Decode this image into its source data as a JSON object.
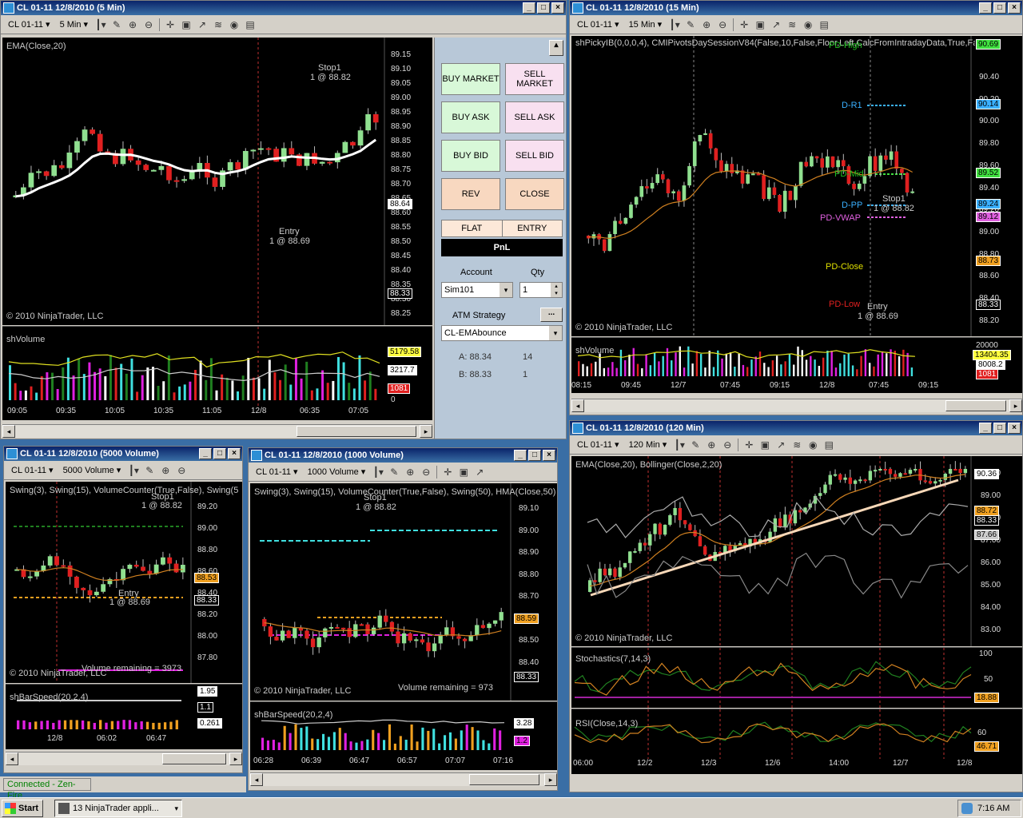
{
  "windows": {
    "w5min": {
      "title": "CL 01-11  12/8/2010 (5 Min)",
      "instrument": "CL 01-11",
      "interval": "5 Min",
      "indicator": "EMA(Close,20)",
      "copyright": "© 2010 NinjaTrader, LLC",
      "stop_label": "Stop1",
      "stop_qty": "1 @ 88.82",
      "entry_label": "Entry",
      "entry_qty": "1 @ 88.69",
      "axis": [
        "89.15",
        "89.10",
        "89.05",
        "89.00",
        "88.95",
        "88.90",
        "88.85",
        "88.80",
        "88.75",
        "88.70",
        "88.65",
        "88.60",
        "88.55",
        "88.50",
        "88.45",
        "88.40",
        "88.35",
        "88.30",
        "88.25"
      ],
      "last_price": "88.64",
      "bid_price": "88.33",
      "vol_label": "shVolume",
      "vol_tags": [
        "5179.58",
        "3217.7",
        "1081"
      ],
      "vol_zero": "0",
      "times": [
        "09:05",
        "09:35",
        "10:05",
        "10:35",
        "11:05",
        "12/8",
        "06:35",
        "07:05"
      ]
    },
    "w15min": {
      "title": "CL 01-11  12/8/2010 (15 Min)",
      "instrument": "CL 01-11",
      "interval": "15 Min",
      "indicator": "shPickyIB(0,0,0,4),  CMIPivotsDaySessionV84(False,10,False,Floor,Left,CalcFromIntradayData,True,False",
      "copyright": "© 2010 NinjaTrader, LLC",
      "pivots": [
        "PD-High",
        "D-R1",
        "PD-Mid",
        "D-PP",
        "PD-VWAP",
        "PD-Close",
        "PD-Low"
      ],
      "stop_label": "Stop1",
      "stop_qty": "1 @ 88.82",
      "entry_label": "Entry",
      "entry_qty": "1 @ 88.69",
      "axis": [
        "90.40",
        "90.20",
        "90.00",
        "89.80",
        "89.60",
        "89.40",
        "89.20",
        "89.00",
        "88.80",
        "88.60",
        "88.40",
        "88.20"
      ],
      "tags": [
        "90.69",
        "90.14",
        "89.52",
        "89.24",
        "89.12",
        "88.73",
        "88.33"
      ],
      "vol_label": "shVolume",
      "vol_tags": [
        "20000",
        "13404.35",
        "8008.2",
        "1081"
      ],
      "times": [
        "08:15",
        "09:45",
        "12/7",
        "07:45",
        "09:15",
        "12/8",
        "07:45",
        "09:15"
      ]
    },
    "w5000v": {
      "title": "CL 01-11  12/8/2010 (5000 Volume)",
      "instrument": "CL 01-11",
      "interval": "5000 Volume",
      "indicator": "Swing(3), Swing(15), VolumeCounter(True,False), Swing(5",
      "copyright": "© 2010 NinjaTrader, LLC",
      "remaining": "Volume remaining = 3973",
      "stop_label": "Stop1",
      "stop_qty": "1 @ 88.82",
      "entry_label": "Entry",
      "entry_qty": "1 @ 88.69",
      "axis": [
        "89.20",
        "89.00",
        "88.80",
        "88.60",
        "88.40",
        "88.20",
        "88.00",
        "87.80"
      ],
      "tags": [
        "88.53",
        "88.33"
      ],
      "sub_label": "shBarSpeed(20,2,4)",
      "sub_tags": [
        "1.95",
        "1.1",
        "0.261"
      ],
      "times": [
        "12/8",
        "06:02",
        "06:47"
      ]
    },
    "w1000v": {
      "title": "CL 01-11  12/8/2010 (1000 Volume)",
      "instrument": "CL 01-11",
      "interval": "1000 Volume",
      "indicator": "Swing(3), Swing(15), VolumeCounter(True,False), Swing(50), HMA(Close,50)",
      "copyright": "© 2010 NinjaTrader, LLC",
      "remaining": "Volume remaining = 973",
      "stop_label": "Stop1",
      "stop_qty": "1 @ 88.82",
      "axis": [
        "89.10",
        "89.00",
        "88.90",
        "88.80",
        "88.70",
        "88.60",
        "88.50",
        "88.40"
      ],
      "tags": [
        "88.59",
        "88.33"
      ],
      "sub_label": "shBarSpeed(20,2,4)",
      "sub_tags": [
        "3.28",
        "1.2"
      ],
      "times": [
        "06:28",
        "06:39",
        "06:47",
        "06:57",
        "07:07",
        "07:16"
      ]
    },
    "w120": {
      "title": "CL 01-11  12/8/2010 (120 Min)",
      "instrument": "CL 01-11",
      "interval": "120 Min",
      "indicator": "EMA(Close,20), Bollinger(Close,2,20)",
      "copyright": "© 2010 NinjaTrader, LLC",
      "axis": [
        "90.00",
        "89.00",
        "88.00",
        "87.00",
        "86.00",
        "85.00",
        "84.00",
        "83.00"
      ],
      "tags": [
        "90.36",
        "88.72",
        "88.33",
        "87.66"
      ],
      "stoch_label": "Stochastics(7,14,3)",
      "stoch_axis": [
        "100",
        "50"
      ],
      "stoch_tag": "18.88",
      "rsi_label": "RSI(Close,14,3)",
      "rsi_axis": [
        "60",
        "40"
      ],
      "rsi_tag": "46.71",
      "times": [
        "06:00",
        "12/2",
        "12/3",
        "12/6",
        "14:00",
        "12/7",
        "12/8"
      ]
    }
  },
  "dom": {
    "buy_market": "BUY MARKET",
    "sell_market": "SELL MARKET",
    "buy_ask": "BUY ASK",
    "sell_ask": "SELL ASK",
    "buy_bid": "BUY BID",
    "sell_bid": "SELL BID",
    "rev": "REV",
    "close": "CLOSE",
    "flat": "FLAT",
    "entry": "ENTRY",
    "pnl": "PnL",
    "account_label": "Account",
    "qty_label": "Qty",
    "account": "Sim101",
    "qty": "1",
    "atm_label": "ATM Strategy",
    "atm": "CL-EMAbounce",
    "atm_more": "...",
    "a_label": "A: 88.34",
    "a_val": "14",
    "b_label": "B: 88.33",
    "b_val": "1"
  },
  "status": {
    "connection": "Connected - Zen-Fire"
  },
  "taskbar": {
    "start": "Start",
    "task": "13 NinjaTrader appli...",
    "clock": "7:16 AM"
  },
  "colors": {
    "up": "#90e090",
    "down": "#e02020",
    "titlebar": "#0a246a"
  }
}
